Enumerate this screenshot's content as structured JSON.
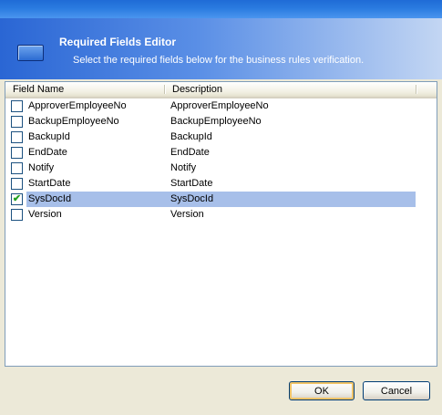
{
  "header": {
    "title": "Required Fields Editor",
    "subtitle": "Select the required fields below for the business rules verification."
  },
  "list": {
    "columns": [
      "Field Name",
      "Description"
    ],
    "rows": [
      {
        "name": "ApproverEmployeeNo",
        "description": "ApproverEmployeeNo",
        "checked": false,
        "selected": false
      },
      {
        "name": "BackupEmployeeNo",
        "description": "BackupEmployeeNo",
        "checked": false,
        "selected": false
      },
      {
        "name": "BackupId",
        "description": "BackupId",
        "checked": false,
        "selected": false
      },
      {
        "name": "EndDate",
        "description": "EndDate",
        "checked": false,
        "selected": false
      },
      {
        "name": "Notify",
        "description": "Notify",
        "checked": false,
        "selected": false
      },
      {
        "name": "StartDate",
        "description": "StartDate",
        "checked": false,
        "selected": false
      },
      {
        "name": "SysDocId",
        "description": "SysDocId",
        "checked": true,
        "selected": true
      },
      {
        "name": "Version",
        "description": "Version",
        "checked": false,
        "selected": false
      }
    ]
  },
  "buttons": {
    "ok": "OK",
    "cancel": "Cancel"
  },
  "colors": {
    "header_start": "#2a66d4",
    "selection": "#a7bfe9",
    "checkmark": "#21a121"
  }
}
